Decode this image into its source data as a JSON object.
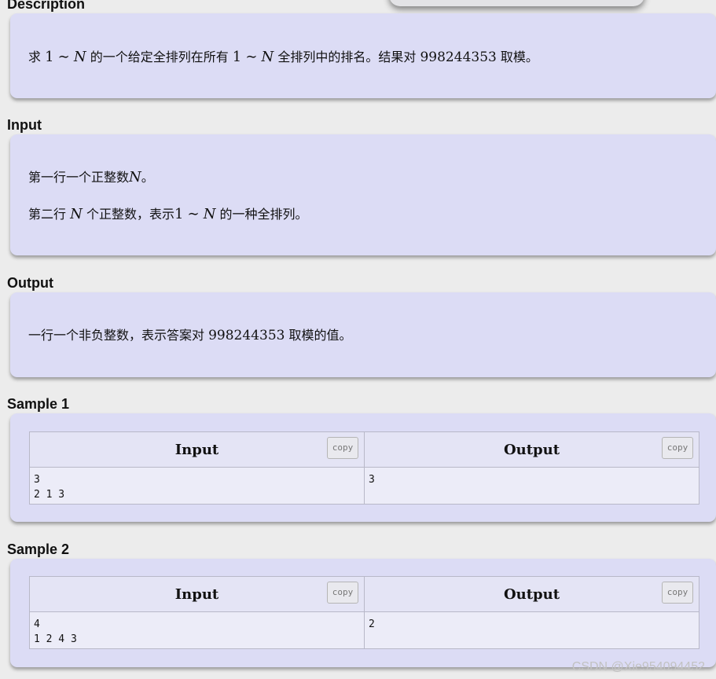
{
  "description": {
    "title": "Description",
    "text": {
      "p1": "求",
      "one_a": "1",
      "tilde_a": "∼",
      "n_a": "N",
      "p2": "的一个给定全排列在所有",
      "one_b": "1",
      "tilde_b": "∼",
      "n_b": "N",
      "p3": "全排列中的排名。结果对",
      "mod": "998244353",
      "p4": "取模。"
    }
  },
  "input": {
    "title": "Input",
    "line1": {
      "p1": "第一行一个正整数",
      "n": "N",
      "p2": "。"
    },
    "line2": {
      "p1": "第二行",
      "n_a": "N",
      "p2": "个正整数，表示",
      "one": "1",
      "tilde": "∼",
      "n_b": "N",
      "p3": "的一种全排列。"
    }
  },
  "output": {
    "title": "Output",
    "line1": {
      "p1": "一行一个非负整数，表示答案对",
      "mod": "998244353",
      "p2": "取模的值。"
    }
  },
  "samples": [
    {
      "title": "Sample 1",
      "input_header": "Input",
      "output_header": "Output",
      "copy_label": "copy",
      "input_lines": [
        "3",
        "2 1 3"
      ],
      "output_lines": [
        "3"
      ]
    },
    {
      "title": "Sample 2",
      "input_header": "Input",
      "output_header": "Output",
      "copy_label": "copy",
      "input_lines": [
        "4",
        "1 2 4 3"
      ],
      "output_lines": [
        "2"
      ]
    }
  ],
  "watermark": "CSDN @Xie954094452"
}
